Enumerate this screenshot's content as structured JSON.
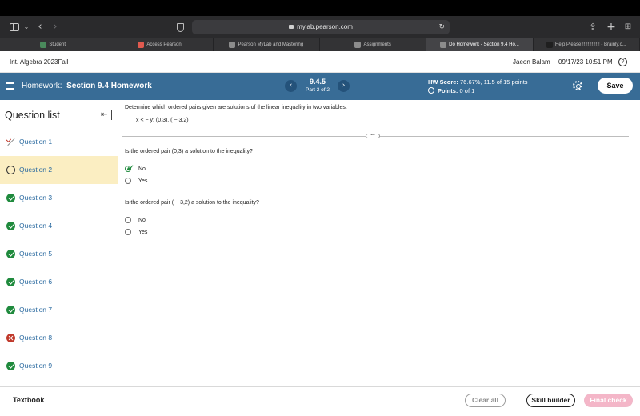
{
  "browser": {
    "url": "mylab.pearson.com",
    "tabs": [
      {
        "label": "Student",
        "active": false,
        "favicon_color": "#4a8a5c"
      },
      {
        "label": "Access Pearson",
        "active": false,
        "favicon_color": "#e05a4f"
      },
      {
        "label": "Pearson MyLab and Mastering",
        "active": false,
        "favicon_color": "#8c8c8c"
      },
      {
        "label": "Assignments",
        "active": false,
        "favicon_color": "#8c8c8c"
      },
      {
        "label": "Do Homework - Section 9.4 Ho...",
        "active": true,
        "favicon_color": "#8c8c8c"
      },
      {
        "label": "Help Please!!!!!!!!!!!!!! - Brainly.c...",
        "active": false,
        "favicon_color": "#1f1f1f"
      }
    ]
  },
  "course": {
    "title": "Int. Algebra 2023Fall",
    "user": "Jaeon Balam",
    "datetime": "09/17/23 10:51 PM",
    "help": "?"
  },
  "homework": {
    "prefix": "Homework:",
    "name": "Section 9.4 Homework",
    "question_number": "9.4.5",
    "part": "Part 2 of 2",
    "score_label": "HW Score:",
    "score_value": "76.67%, 11.5 of 15 points",
    "points_label": "Points:",
    "points_value": "0 of 1",
    "save_label": "Save",
    "prev_glyph": "‹",
    "next_glyph": "›"
  },
  "question_list": {
    "title": "Question list",
    "items": [
      {
        "label": "Question 1",
        "status": "partial"
      },
      {
        "label": "Question 2",
        "status": "current"
      },
      {
        "label": "Question 3",
        "status": "correct"
      },
      {
        "label": "Question 4",
        "status": "correct"
      },
      {
        "label": "Question 5",
        "status": "correct"
      },
      {
        "label": "Question 6",
        "status": "correct"
      },
      {
        "label": "Question 7",
        "status": "correct"
      },
      {
        "label": "Question 8",
        "status": "incorrect"
      },
      {
        "label": "Question 9",
        "status": "correct"
      }
    ]
  },
  "problem": {
    "stem": "Determine which ordered pairs given are solutions of the linear inequality in two variables.",
    "inequality": "x < − y;  (0,3), ( − 3,2)",
    "divider_handle": "•••",
    "parts": [
      {
        "question": "Is the ordered pair (0,3) a solution to the inequality?",
        "options": [
          {
            "label": "No",
            "selected": true
          },
          {
            "label": "Yes",
            "selected": false
          }
        ]
      },
      {
        "question": "Is the ordered pair ( − 3,2) a solution to the inequality?",
        "options": [
          {
            "label": "No",
            "selected": false
          },
          {
            "label": "Yes",
            "selected": false
          }
        ]
      }
    ]
  },
  "footer": {
    "textbook": "Textbook",
    "clear_all": "Clear all",
    "skill_builder": "Skill builder",
    "final_check": "Final check"
  },
  "colors": {
    "header_blue": "#386c96",
    "current_highlight": "#fbeec2",
    "correct_green": "#1f8a3d",
    "incorrect_red": "#c0392b",
    "link_blue": "#2a6aa0",
    "final_check_pink": "#f4b6c8"
  }
}
